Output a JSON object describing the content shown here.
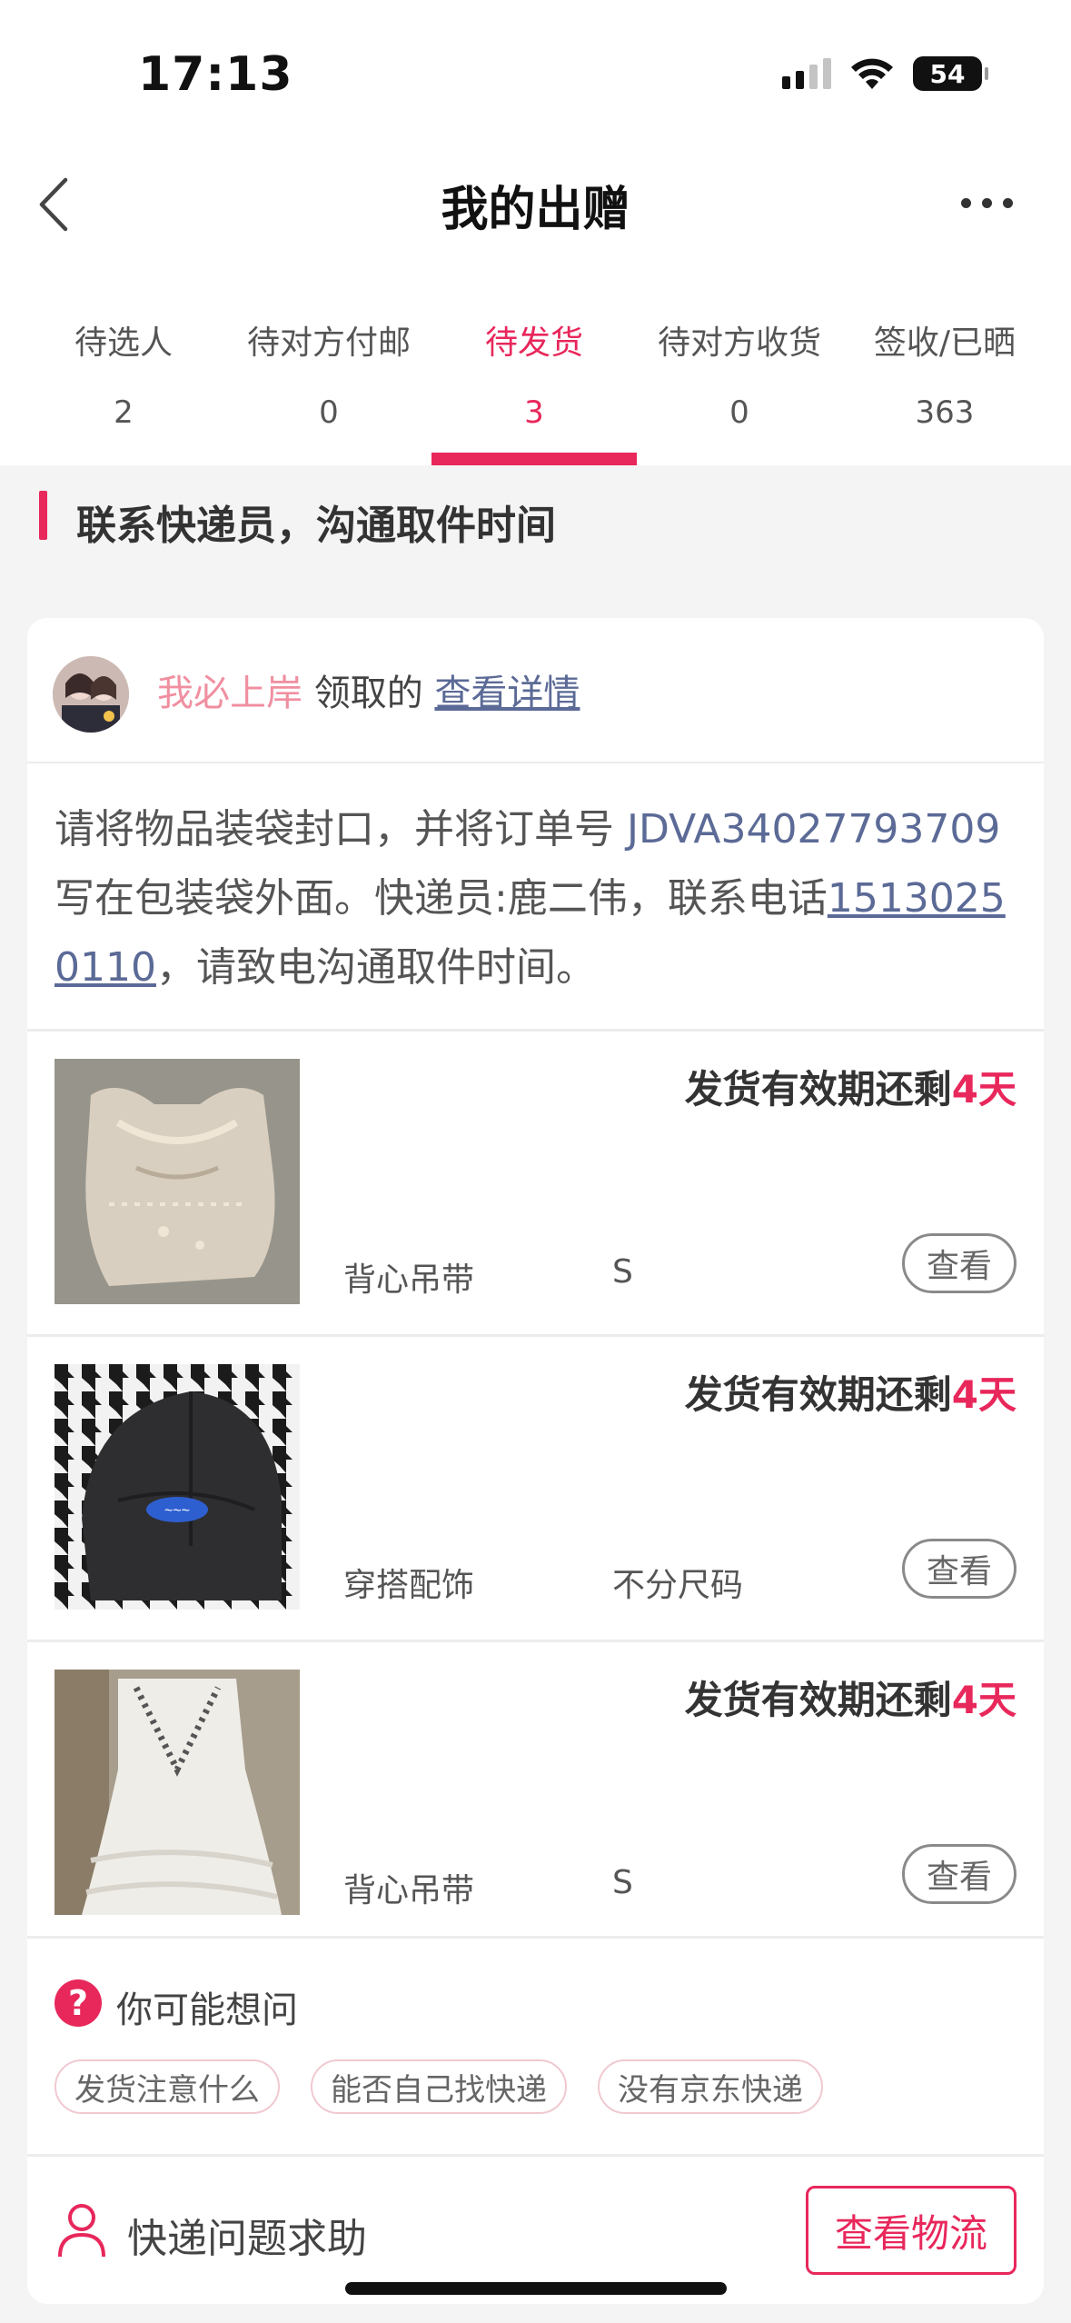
{
  "status_bar": {
    "time": "17:13",
    "battery": "54"
  },
  "nav": {
    "title": "我的出赠"
  },
  "tabs": [
    {
      "label": "待选人",
      "count": "2",
      "active": false
    },
    {
      "label": "待对方付邮",
      "count": "0",
      "active": false
    },
    {
      "label": "待发货",
      "count": "3",
      "active": true
    },
    {
      "label": "待对方收货",
      "count": "0",
      "active": false
    },
    {
      "label": "签收/已晒",
      "count": "363",
      "active": false
    }
  ],
  "section": {
    "title": "联系快递员，沟通取件时间"
  },
  "claim": {
    "name": "我必上岸",
    "suffix": " 领取的 ",
    "link": "查看详情"
  },
  "instructions": {
    "text_before": "请将物品装袋封口，并将订单号 ",
    "order_no": "JDVA34027793709",
    "text_middle": " 写在包装袋外面。快递员:鹿二伟，联系电话",
    "phone": "15130250110",
    "text_after": "，请致电沟通取件时间。"
  },
  "items": [
    {
      "deadline_prefix": "发货有效期还剩",
      "deadline_days": "4天",
      "category": "背心吊带",
      "size": "S",
      "view_label": "查看"
    },
    {
      "deadline_prefix": "发货有效期还剩",
      "deadline_days": "4天",
      "category": "穿搭配饰",
      "size": "不分尺码",
      "view_label": "查看"
    },
    {
      "deadline_prefix": "发货有效期还剩",
      "deadline_days": "4天",
      "category": "背心吊带",
      "size": "S",
      "view_label": "查看"
    }
  ],
  "faq": {
    "icon": "?",
    "title": "你可能想问",
    "chips": [
      "发货注意什么",
      "能否自己找快递",
      "没有京东快递"
    ]
  },
  "bottom": {
    "help_text": "快递问题求助",
    "track_label": "查看物流"
  },
  "colors": {
    "accent": "#e8275b",
    "link": "#5b6a96",
    "claim_name": "#f08fa0"
  }
}
